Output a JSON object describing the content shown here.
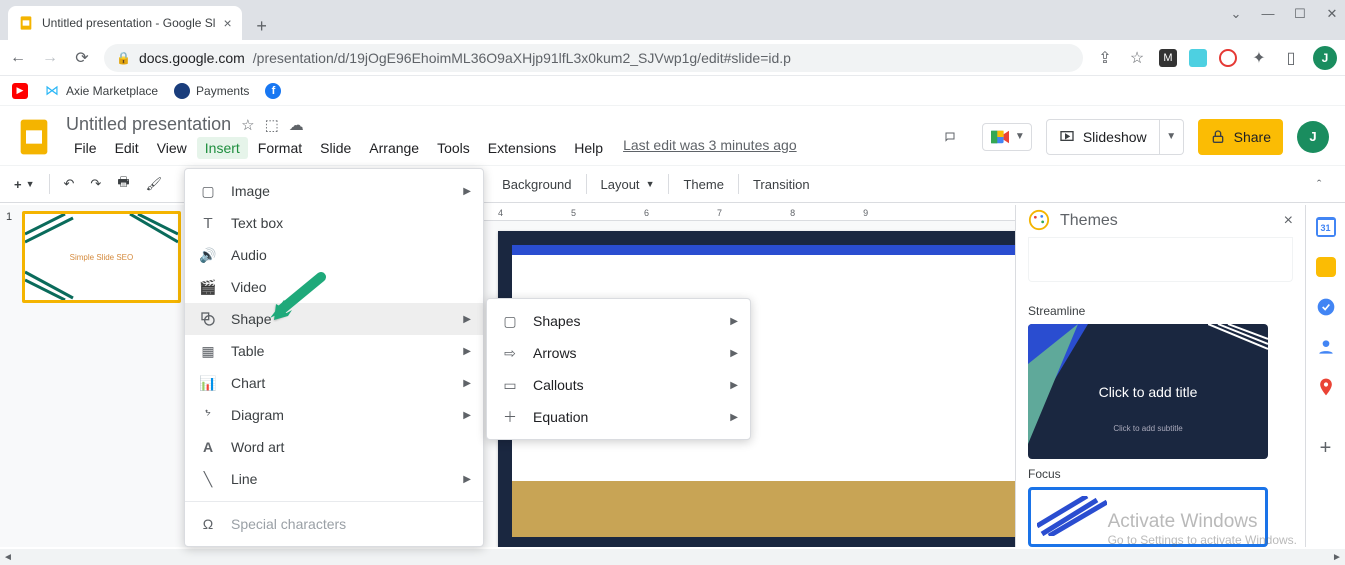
{
  "browser": {
    "tab_title": "Untitled presentation - Google Sl",
    "url_domain": "docs.google.com",
    "url_path": "/presentation/d/19jOgE96EhoimML36O9aXHjp91lfL3x0kum2_SJVwp1g/edit#slide=id.p",
    "bookmarks": [
      {
        "label": "Axie Marketplace"
      },
      {
        "label": "Payments"
      }
    ],
    "avatar_letter": "J"
  },
  "doc": {
    "title": "Untitled presentation",
    "last_edit": "Last edit was 3 minutes ago"
  },
  "menubar": [
    "File",
    "Edit",
    "View",
    "Insert",
    "Format",
    "Slide",
    "Arrange",
    "Tools",
    "Extensions",
    "Help"
  ],
  "active_menu_index": 3,
  "header_buttons": {
    "slideshow": "Slideshow",
    "share": "Share"
  },
  "toolbar": {
    "background": "Background",
    "layout": "Layout",
    "theme": "Theme",
    "transition": "Transition"
  },
  "insert_menu": [
    {
      "label": "Image",
      "icon": "▢",
      "sub": true
    },
    {
      "label": "Text box",
      "icon": "𝖳"
    },
    {
      "label": "Audio",
      "icon": "🔊"
    },
    {
      "label": "Video",
      "icon": "🎬"
    },
    {
      "label": "Shape",
      "icon": "◯",
      "sub": true,
      "hover": true
    },
    {
      "label": "Table",
      "icon": "▦",
      "sub": true
    },
    {
      "label": "Chart",
      "icon": "▥",
      "sub": true
    },
    {
      "label": "Diagram",
      "icon": "ᖮ",
      "sub": true
    },
    {
      "label": "Word art",
      "icon": "A"
    },
    {
      "label": "Line",
      "icon": "╲",
      "sub": true
    },
    {
      "sep": true
    },
    {
      "label": "Special characters",
      "icon": "Ω",
      "disabled": true
    }
  ],
  "shape_submenu": [
    {
      "label": "Shapes",
      "icon": "▢",
      "sub": true
    },
    {
      "label": "Arrows",
      "icon": "⇨",
      "sub": true
    },
    {
      "label": "Callouts",
      "icon": "▭",
      "sub": true
    },
    {
      "label": "Equation",
      "icon": "＋",
      "sub": true
    }
  ],
  "filmstrip": {
    "slide1_num": "1",
    "slide1_text": "Simple Slide SEO"
  },
  "ruler_marks": [
    "4",
    "5",
    "6",
    "7",
    "8",
    "9"
  ],
  "themes_panel": {
    "title": "Themes",
    "theme1_name": "Streamline",
    "theme1_placeholder": "Click to add title",
    "theme1_sub": "Click to add subtitle",
    "theme2_name": "Focus"
  },
  "watermark": {
    "line1": "Activate Windows",
    "line2": "Go to Settings to activate Windows."
  }
}
